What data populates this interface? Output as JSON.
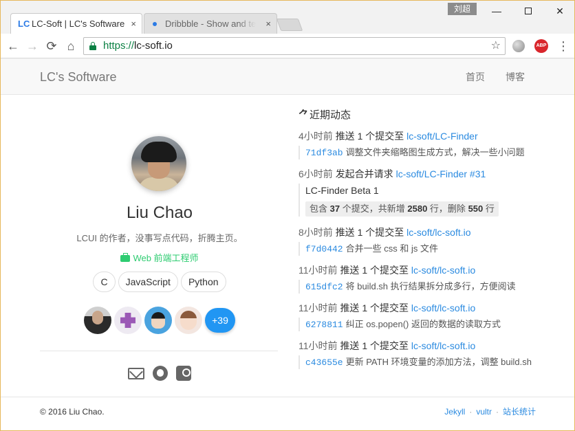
{
  "window": {
    "user_badge": "刘超",
    "minimize": "—",
    "close": "✕"
  },
  "tabs": [
    {
      "favicon": "LC",
      "title": "LC-Soft | LC's Software",
      "close": "×",
      "active": true
    },
    {
      "favicon": "dribbble-dot-icon",
      "title": "Dribbble - Show and tell for designers",
      "close": "×",
      "active": false
    }
  ],
  "toolbar": {
    "back": "←",
    "forward": "→",
    "reload": "⟳",
    "home": "⌂",
    "url_scheme": "https://",
    "url_host": "lc-soft.io",
    "star": "☆",
    "abp_label": "ABP",
    "menu": "⋮"
  },
  "site": {
    "brand": "LC's Software",
    "nav": [
      "首页",
      "博客"
    ]
  },
  "profile": {
    "name": "Liu Chao",
    "bio": "LCUI 的作者，没事写点代码，折腾主页。",
    "job": "Web 前端工程师",
    "tags": [
      "C",
      "JavaScript",
      "Python"
    ],
    "followers_more": "+39"
  },
  "activity": {
    "heading_icon": "⺈",
    "heading": "近期动态",
    "items": [
      {
        "time": "4小时前",
        "verb": "推送 1 个提交至",
        "repo": "lc-soft/LC-Finder",
        "sha": "71df3ab",
        "message": "调整文件夹缩略图生成方式，解决一些小问题"
      },
      {
        "time": "6小时前",
        "verb": "发起合并请求",
        "repo": "lc-soft/LC-Finder #31",
        "pr_title": "LC-Finder Beta 1",
        "pr_stats": {
          "prefix": "包含",
          "commits": "37",
          "mid1": "个提交，共新增",
          "added": "2580",
          "mid2": "行，删除",
          "removed": "550",
          "suffix": "行"
        }
      },
      {
        "time": "8小时前",
        "verb": "推送 1 个提交至",
        "repo": "lc-soft/lc-soft.io",
        "sha": "f7d0442",
        "message": "合并一些 css 和 js 文件"
      },
      {
        "time": "11小时前",
        "verb": "推送 1 个提交至",
        "repo": "lc-soft/lc-soft.io",
        "sha": "615dfc2",
        "message": "将 build.sh 执行结果拆分成多行，方便阅读"
      },
      {
        "time": "11小时前",
        "verb": "推送 1 个提交至",
        "repo": "lc-soft/lc-soft.io",
        "sha": "6278811",
        "message": "纠正 os.popen() 返回的数据的读取方式"
      },
      {
        "time": "11小时前",
        "verb": "推送 1 个提交至",
        "repo": "lc-soft/lc-soft.io",
        "sha": "c43655e",
        "message": "更新 PATH 环境变量的添加方法，调整 build.sh"
      }
    ]
  },
  "footer": {
    "copyright": "© 2016 Liu Chao.",
    "links": [
      "Jekyll",
      "vultr",
      "站长统计"
    ],
    "separator": "·"
  },
  "colors": {
    "link": "#2a8ae0",
    "job_green": "#2ecc71",
    "followers_more_bg": "#2196f3",
    "secure_green": "#0b8043"
  }
}
